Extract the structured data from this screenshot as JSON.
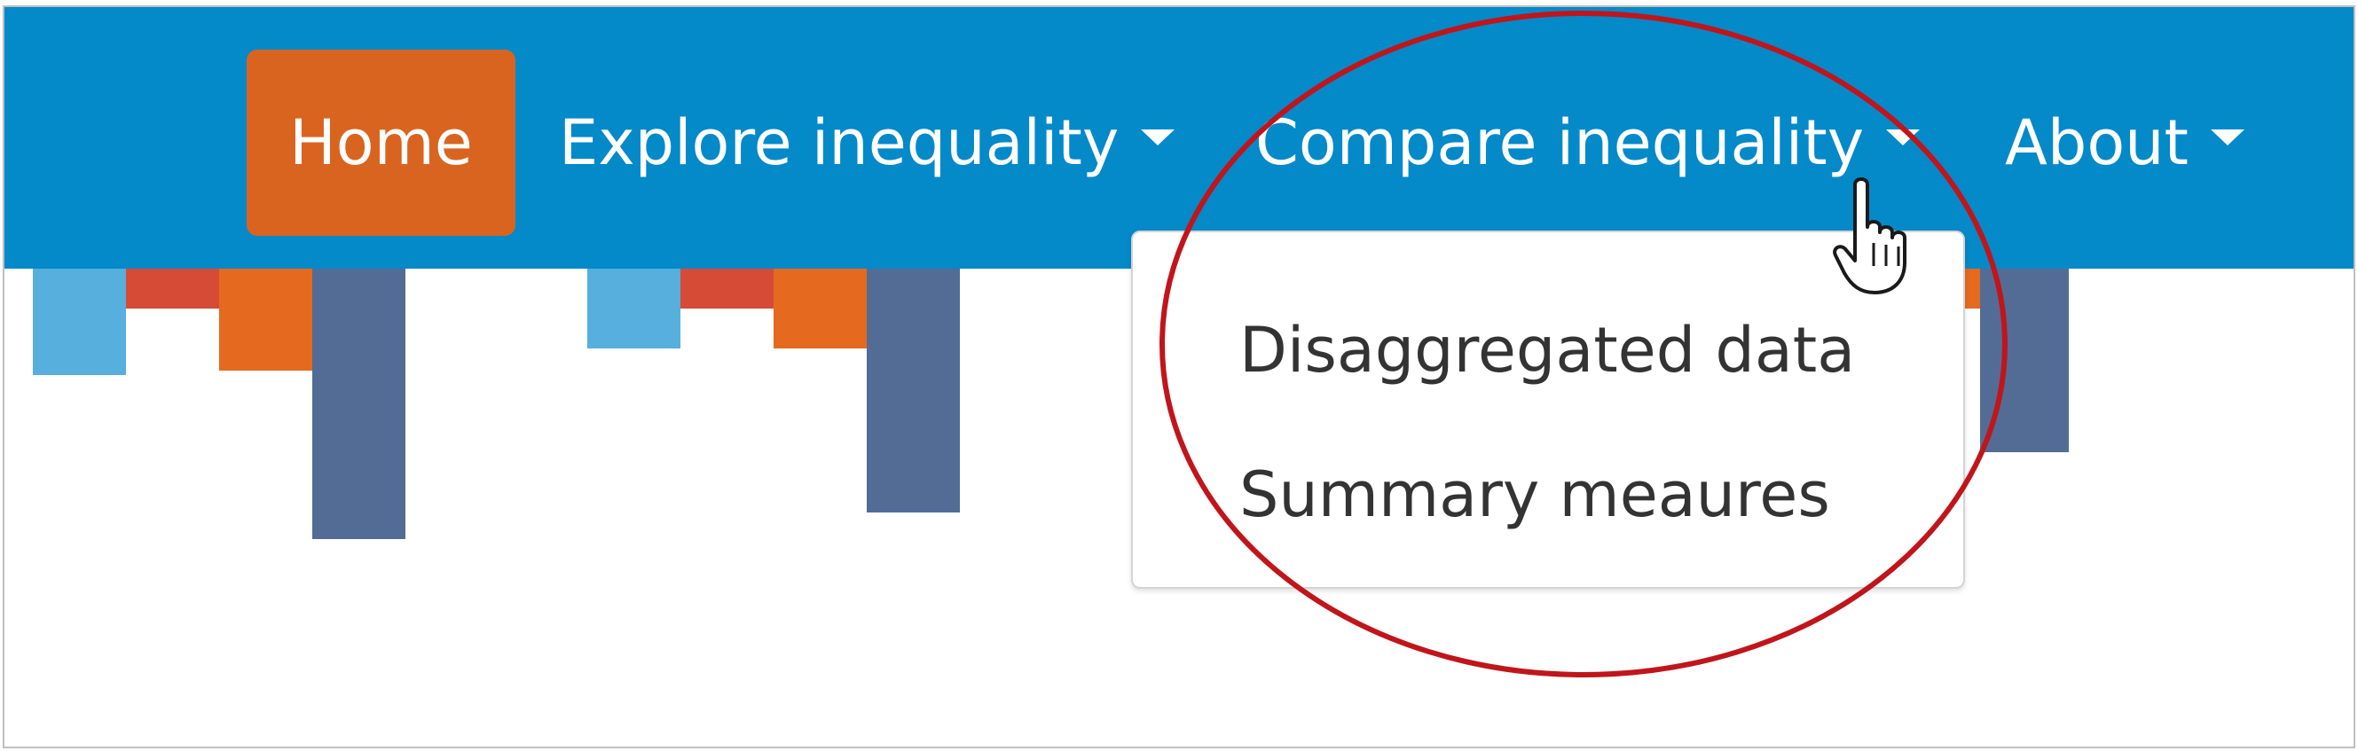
{
  "nav": {
    "home": "Home",
    "explore": "Explore inequality",
    "compare": "Compare inequality",
    "about": "About"
  },
  "dropdown": {
    "items": [
      "Disaggregated data",
      "Summary meaures"
    ]
  },
  "colors": {
    "navbar": "#0489c9",
    "home_active": "#d96420",
    "annotation_circle": "#c0151b",
    "bar_light_blue": "#56afdc",
    "bar_red": "#d64b36",
    "bar_orange": "#e5691f",
    "bar_slate": "#536c96"
  },
  "icons": {
    "cursor": "hand-pointer-icon"
  }
}
